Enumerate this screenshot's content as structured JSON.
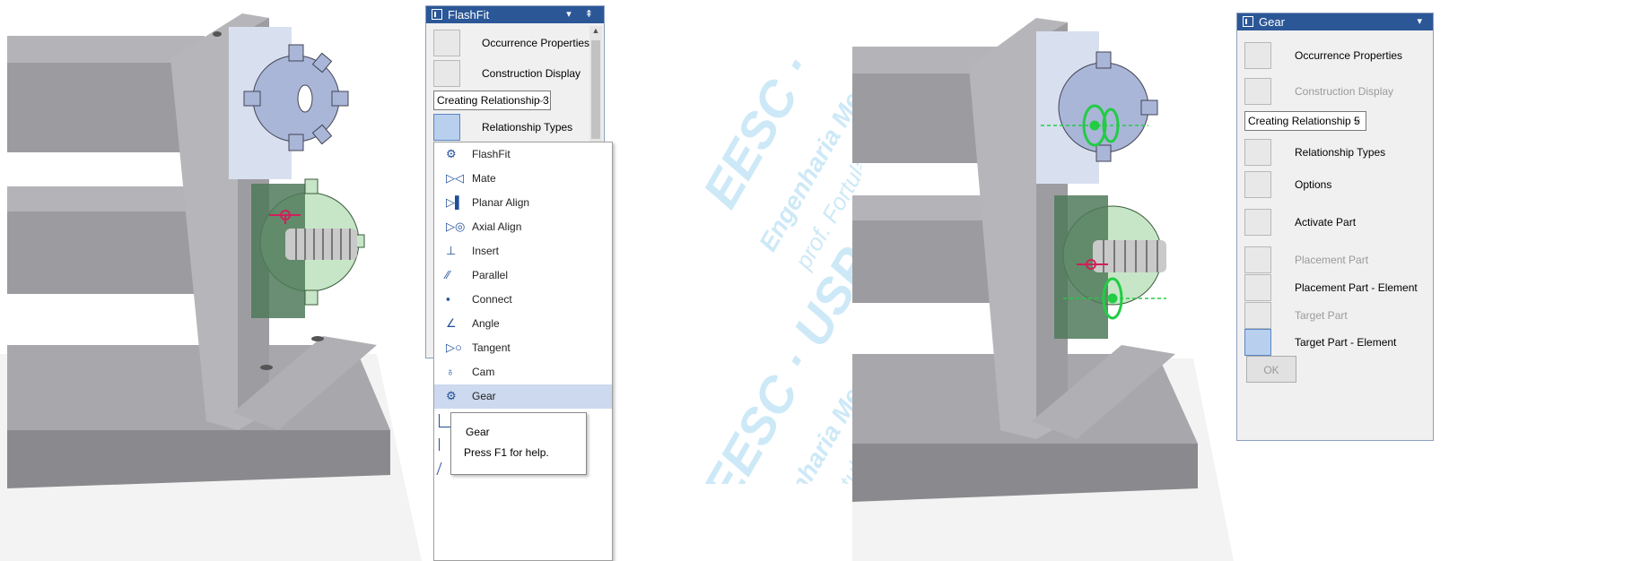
{
  "left_panel": {
    "title": "FlashFit",
    "title_buttons": "▾ ⇞",
    "occurrence_properties": "Occurrence Properties",
    "construction_display": "Construction Display",
    "relationship_select": "Creating Relationship 3",
    "relationship_types": "Relationship Types"
  },
  "relationship_menu": [
    {
      "label": "FlashFit",
      "icon": "flashfit-icon"
    },
    {
      "label": "Mate",
      "icon": "mate-icon"
    },
    {
      "label": "Planar Align",
      "icon": "planar-align-icon"
    },
    {
      "label": "Axial Align",
      "icon": "axial-align-icon"
    },
    {
      "label": "Insert",
      "icon": "insert-icon"
    },
    {
      "label": "Parallel",
      "icon": "parallel-icon"
    },
    {
      "label": "Connect",
      "icon": "connect-icon"
    },
    {
      "label": "Angle",
      "icon": "angle-icon"
    },
    {
      "label": "Tangent",
      "icon": "tangent-icon"
    },
    {
      "label": "Cam",
      "icon": "cam-icon"
    },
    {
      "label": "Gear",
      "icon": "gear-icon"
    }
  ],
  "highlighted_menu_item": "Gear",
  "tooltip": {
    "title": "Gear",
    "help": "Press F1 for help."
  },
  "right_panel": {
    "title": "Gear",
    "occurrence_properties": "Occurrence Properties",
    "construction_display": "Construction Display",
    "relationship_select": "Creating Relationship 5",
    "relationship_types": "Relationship Types",
    "options": "Options",
    "activate_part": "Activate Part",
    "placement_part": "Placement Part",
    "placement_part_element": "Placement Part - Element",
    "target_part": "Target Part",
    "target_part_element": "Target Part - Element",
    "ok": "OK"
  },
  "watermark": {
    "line1": "EESC · USP",
    "line2": "Engenharia Mecânica",
    "line3": "prof. Fortulan"
  },
  "colors": {
    "titlebar": "#2b5797",
    "gear_blue": "#a9b6d8",
    "gear_green": "#c7e6c7",
    "frame_gray": "#a9a9ad",
    "rack_red": "#d0205a",
    "constraint_green": "#22cc44",
    "watermark": "#cde9f7"
  }
}
